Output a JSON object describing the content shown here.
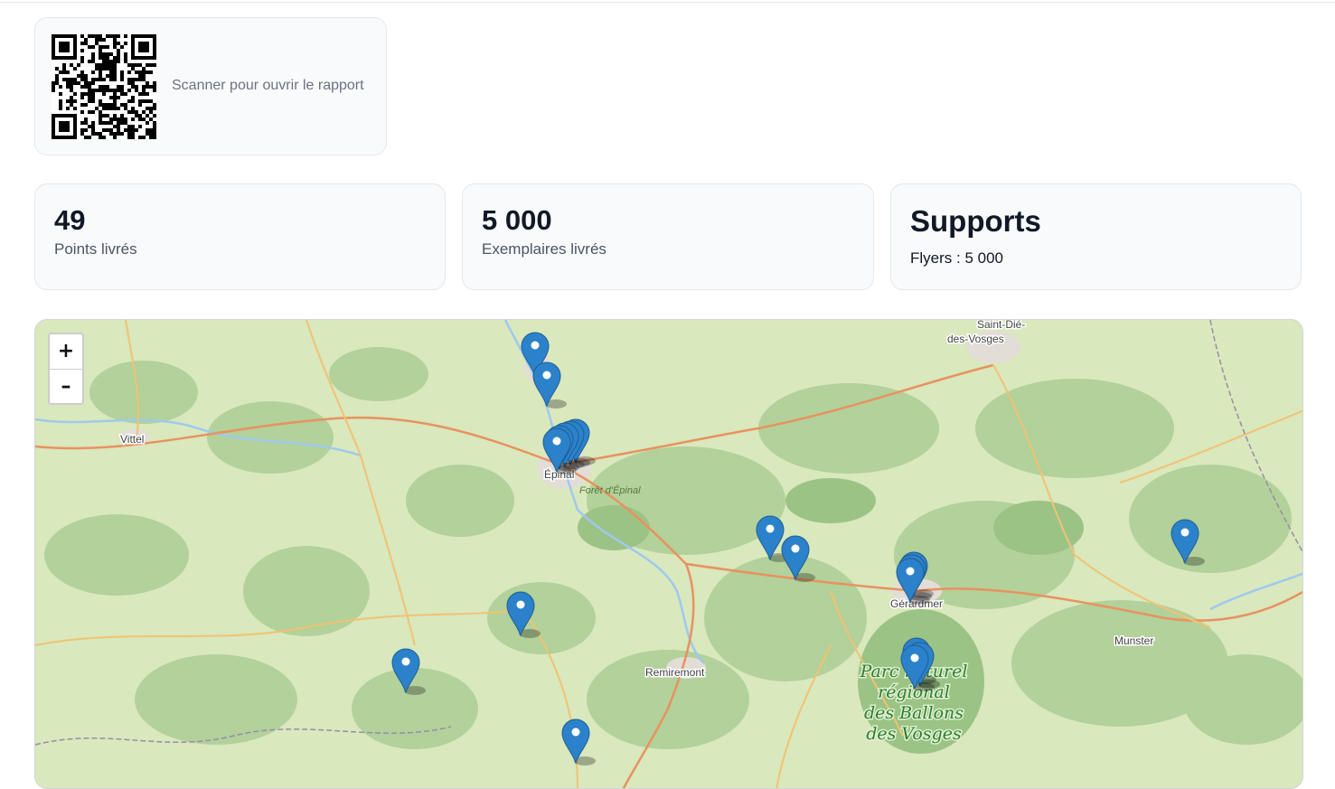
{
  "qr": {
    "caption": "Scanner pour ouvrir le rapport"
  },
  "stats": [
    {
      "value": "49",
      "label": "Points livrés"
    },
    {
      "value": "5 000",
      "label": "Exemplaires livrés"
    }
  ],
  "supports": {
    "title": "Supports",
    "line": "Flyers : 5 000"
  },
  "map": {
    "zoom_in": "+",
    "zoom_out": "–",
    "labels": {
      "saint_die_1": "Saint-Dié-",
      "saint_die_2": "des-Vosges",
      "vittel": "Vittel",
      "epinal": "Épinal",
      "foret": "Forêt d'Épinal",
      "remiremont": "Remiremont",
      "gerardmer": "Gérardmer",
      "munster": "Munster",
      "parc_1": "Parc naturel",
      "parc_2": "régional",
      "parc_3": "des Ballons",
      "parc_4": "des Vosges"
    },
    "marker_color": "#2b82cb",
    "marker_icon": "map-pin-icon"
  }
}
